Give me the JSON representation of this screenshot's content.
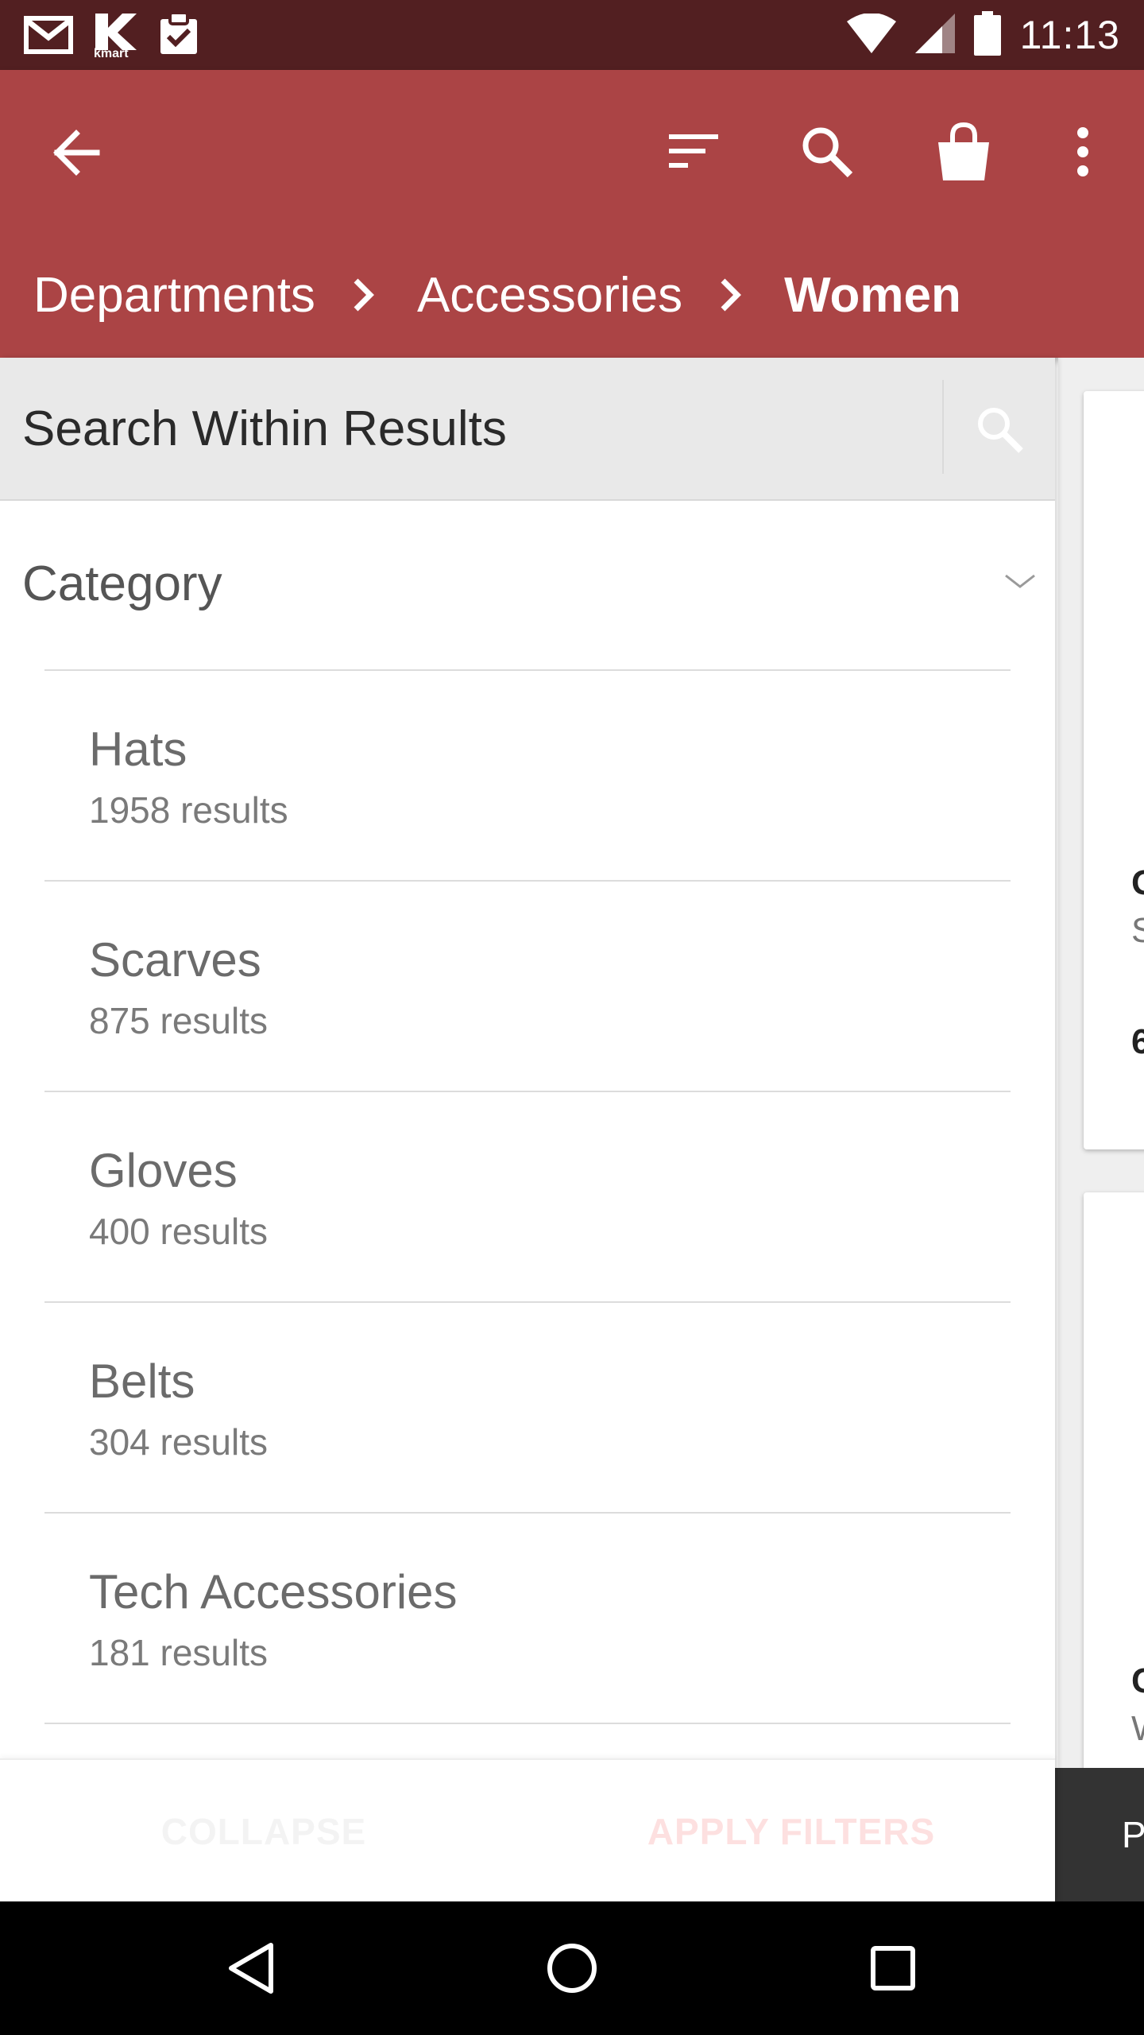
{
  "status_bar": {
    "time": "11:13",
    "notification_icons": [
      "gmail-icon",
      "kmart-icon",
      "clipboard-icon"
    ],
    "kmart_label": "kmart"
  },
  "app_bar": {
    "icons": [
      "back-arrow-icon",
      "sort-icon",
      "search-icon",
      "shopping-bag-icon",
      "more-vert-icon"
    ],
    "color": "#ab4445",
    "breadcrumb": [
      "Departments",
      "Accessories",
      "Women"
    ]
  },
  "filters": {
    "search_placeholder": "Search Within Results",
    "category_title": "Category",
    "categories": [
      {
        "name": "Hats",
        "count": "1958 results"
      },
      {
        "name": "Scarves",
        "count": "875 results"
      },
      {
        "name": "Gloves",
        "count": "400 results"
      },
      {
        "name": "Belts",
        "count": "304 results"
      },
      {
        "name": "Tech Accessories",
        "count": "181 results"
      }
    ],
    "collapse_label": "COLLAPSE",
    "apply_label": "APPLY FILTERS"
  },
  "background_products": {
    "card1_lines": [
      "G",
      "S",
      "6"
    ],
    "card2_lines": [
      "C",
      "W"
    ],
    "bottom_button_partial": "P"
  }
}
